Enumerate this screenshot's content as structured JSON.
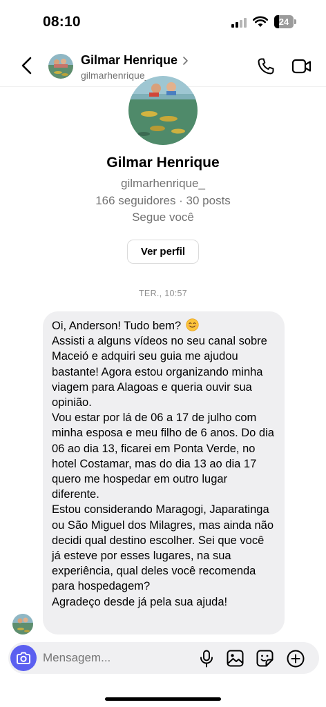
{
  "status_bar": {
    "time": "08:10",
    "battery_level": "24",
    "icons": [
      "signal-icon",
      "wifi-icon",
      "battery-icon"
    ]
  },
  "header": {
    "name": "Gilmar Henrique",
    "username": "gilmarhenrique_",
    "icons": [
      "back-arrow-icon",
      "chevron-right-icon",
      "phone-icon",
      "video-camera-icon"
    ]
  },
  "profile": {
    "name": "Gilmar Henrique",
    "username": "gilmarhenrique_",
    "stats": "166 seguidores · 30 posts",
    "follows_you": "Segue você",
    "view_profile_label": "Ver perfil"
  },
  "conversation": {
    "timestamp": "TER., 10:57",
    "message": {
      "greeting": "Oi, Anderson! Tudo bem?",
      "emoji": "smiling-face-emoji",
      "paragraphs": [
        "Assisti a alguns vídeos no seu canal sobre Maceió e adquiri seu guia me ajudou bastante! Agora estou organizando minha viagem para Alagoas e queria ouvir sua opinião.",
        "Vou estar por lá de 06 a 17 de julho com minha esposa e meu filho de 6 anos. Do dia 06 ao dia 13, ficarei em Ponta Verde, no hotel Costamar, mas do dia 13 ao dia 17 quero me hospedar em outro lugar diferente.",
        "Estou considerando Maragogi, Japaratinga ou São Miguel dos Milagres, mas ainda não decidi qual destino escolher. Sei que você já esteve por esses lugares, na sua experiência, qual deles você recomenda para hospedagem?",
        "Agradeço desde já pela sua ajuda!"
      ]
    }
  },
  "composer": {
    "placeholder": "Mensagem...",
    "icons": [
      "camera-icon",
      "microphone-icon",
      "gallery-icon",
      "sticker-icon",
      "plus-icon"
    ]
  },
  "colors": {
    "accent": "#5b5ff0",
    "bubble_background": "#efeff1",
    "secondary_text": "#737373"
  }
}
